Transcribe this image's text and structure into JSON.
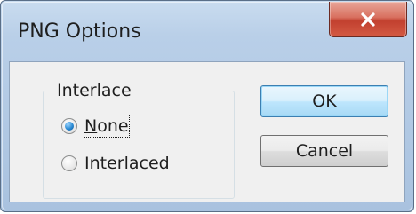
{
  "window": {
    "title": "PNG Options",
    "close_glyph": "x"
  },
  "interlace_group": {
    "label": "Interlace",
    "options": [
      {
        "label_mnemonic": "N",
        "label_rest": "one",
        "selected": true
      },
      {
        "label_mnemonic": "I",
        "label_rest": "nterlaced",
        "selected": false
      }
    ]
  },
  "buttons": {
    "ok_label": "OK",
    "cancel_label": "Cancel"
  },
  "colors": {
    "title_bar": "#b9cfe8",
    "close_button": "#c2402f",
    "dialog_face": "#f0f0f0",
    "default_button_border": "#3c7fb1",
    "radio_selected": "#2a8ad4"
  }
}
